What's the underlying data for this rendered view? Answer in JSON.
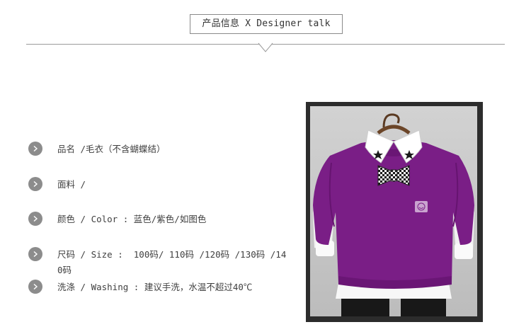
{
  "header": {
    "title": "产品信息 X Designer talk"
  },
  "specs": [
    {
      "text": "品名 /毛衣（不含蝴蝶结）"
    },
    {
      "text": "面料 /"
    },
    {
      "text": "颜色 / Color : 蓝色/紫色/如图色"
    },
    {
      "text": "尺码 / Size :  100码/ 110码 /120码 /130码 /140码"
    },
    {
      "text": "洗涤 / Washing : 建议手洗，水温不超过40℃"
    }
  ],
  "product_photo": {
    "sweater_color": "#7a1e86",
    "background_color": "#c8c8c8"
  },
  "colors": {
    "bullet": "#8c8c8c",
    "divider": "#9a9a9a"
  }
}
